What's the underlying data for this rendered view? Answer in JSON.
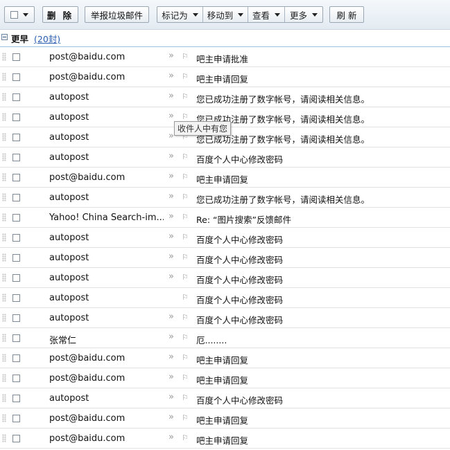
{
  "toolbar": {
    "delete": "删 除",
    "report_spam": "举报垃圾邮件",
    "mark_as": "标记为",
    "move_to": "移动到",
    "view": "查看",
    "more": "更多",
    "refresh": "刷 新"
  },
  "group": {
    "title": "更早",
    "count": "(20封)"
  },
  "tooltip": "收件人中有您",
  "rows": [
    {
      "sender": "post@baidu.com",
      "subject": "吧主申请批准",
      "arrow": true
    },
    {
      "sender": "post@baidu.com",
      "subject": "吧主申请回复",
      "arrow": true
    },
    {
      "sender": "autopost",
      "subject": "您已成功注册了数字帐号，请阅读相关信息。",
      "arrow": true
    },
    {
      "sender": "autopost",
      "subject": "您已成功注册了数字帐号，请阅读相关信息。",
      "arrow": true
    },
    {
      "sender": "autopost",
      "subject": "您已成功注册了数字帐号，请阅读相关信息。",
      "arrow": true
    },
    {
      "sender": "autopost",
      "subject": "百度个人中心修改密码",
      "arrow": true
    },
    {
      "sender": "post@baidu.com",
      "subject": "吧主申请回复",
      "arrow": true
    },
    {
      "sender": "autopost",
      "subject": "您已成功注册了数字帐号，请阅读相关信息。",
      "arrow": true
    },
    {
      "sender": "Yahoo! China Search-im...",
      "subject": "Re: “图片搜索”反馈邮件",
      "arrow": true
    },
    {
      "sender": "autopost",
      "subject": "百度个人中心修改密码",
      "arrow": true
    },
    {
      "sender": "autopost",
      "subject": "百度个人中心修改密码",
      "arrow": true
    },
    {
      "sender": "autopost",
      "subject": "百度个人中心修改密码",
      "arrow": true
    },
    {
      "sender": "autopost",
      "subject": "百度个人中心修改密码",
      "arrow": false
    },
    {
      "sender": "autopost",
      "subject": "百度个人中心修改密码",
      "arrow": true
    },
    {
      "sender": "张常仁",
      "subject": "厄........",
      "arrow": true
    },
    {
      "sender": "post@baidu.com",
      "subject": "吧主申请回复",
      "arrow": true
    },
    {
      "sender": "post@baidu.com",
      "subject": "吧主申请回复",
      "arrow": true
    },
    {
      "sender": "autopost",
      "subject": "百度个人中心修改密码",
      "arrow": true
    },
    {
      "sender": "post@baidu.com",
      "subject": "吧主申请回复",
      "arrow": true
    },
    {
      "sender": "post@baidu.com",
      "subject": "吧主申请回复",
      "arrow": true
    }
  ]
}
